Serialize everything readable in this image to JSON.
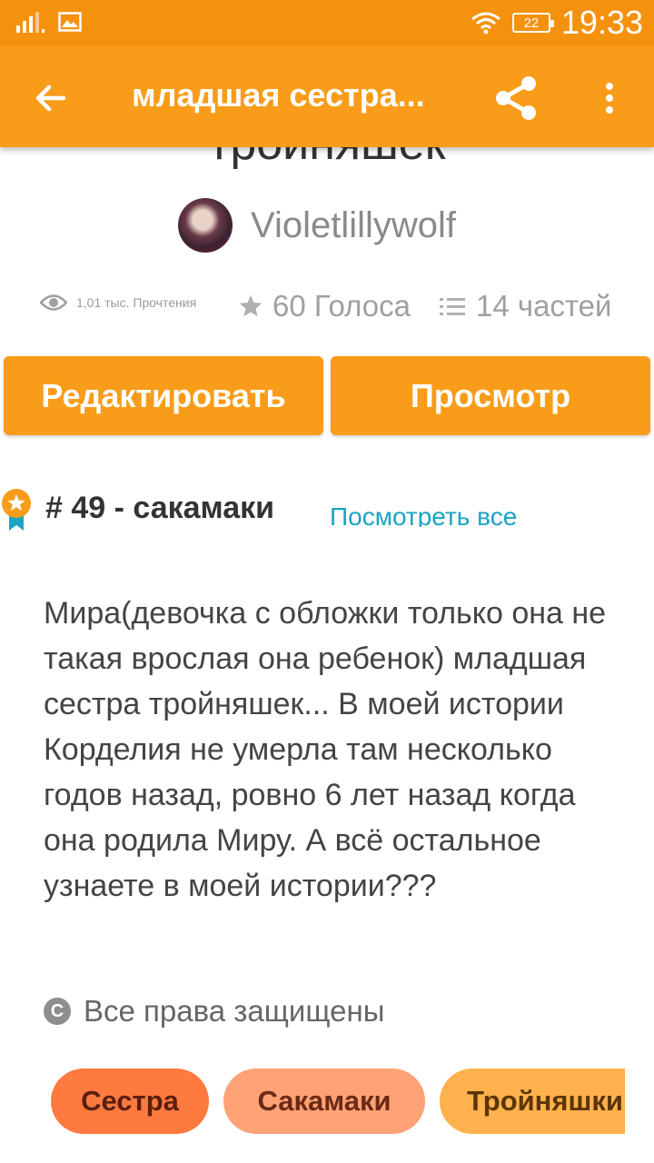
{
  "status_bar": {
    "time": "19:33",
    "battery": "22",
    "icons": [
      "signal-icon",
      "image-notification-icon",
      "wifi-icon",
      "battery-icon"
    ]
  },
  "app_bar": {
    "title": "младшая сестра...",
    "icons": [
      "back-arrow-icon",
      "share-icon",
      "more-vert-icon"
    ]
  },
  "story": {
    "title_partial": "тройняшек",
    "author": "Violetlillywolf",
    "reads": "1,01 тыс. Прочтения",
    "votes": "60 Голоса",
    "parts": "14 частей"
  },
  "actions": {
    "edit_label": "Редактировать",
    "view_label": "Просмотр"
  },
  "rank": {
    "text": "# 49 - сакамаки",
    "see_all": "Посмотреть все"
  },
  "description": "Мира(девочка с обложки только она не такая врослая она ребенок) младшая сестра тройняшек... В моей истории Корделия не умерла там несколько годов назад, ровно 6 лет назад когда она родила Миру. А всё остальное узнаете в моей истории???",
  "copyright": "Все права защищены",
  "tags": [
    "Сестра",
    "Сакамаки",
    "Тройняшки"
  ],
  "colors": {
    "status_bar": "#f4920e",
    "app_bar": "#f89c19",
    "button": "#f89c19",
    "link": "#1ba3c3",
    "tag_1": "#ff7a3f",
    "tag_2": "#ffa275",
    "tag_3": "#ffb14d"
  }
}
